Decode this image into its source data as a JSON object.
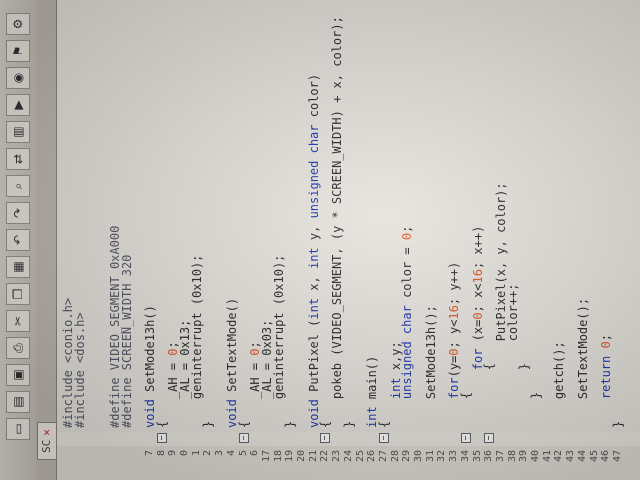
{
  "tab": {
    "label": "SC",
    "close": "✕"
  },
  "toolbar": {
    "icons": [
      "new-file-icon",
      "open-icon",
      "save-icon",
      "print-icon",
      "cut-icon",
      "copy-icon",
      "paste-icon",
      "undo-icon",
      "redo-icon",
      "find-icon",
      "replace-icon",
      "compile-icon",
      "run-icon",
      "debug-icon",
      "bookmark-icon",
      "settings-icon"
    ]
  },
  "code": {
    "lines": [
      {
        "n": "",
        "t": "#include <conio.h>"
      },
      {
        "n": "",
        "t": "#include <dos.h>"
      },
      {
        "n": "",
        "t": ""
      },
      {
        "n": "",
        "t": ""
      },
      {
        "n": "",
        "t": "#define VIDEO_SEGMENT 0xA000"
      },
      {
        "n": "",
        "t": "#define SCREEN_WIDTH 320"
      },
      {
        "n": "",
        "t": ""
      },
      {
        "n": "7",
        "t": "void SetMode13h()"
      },
      {
        "n": "8",
        "t": "{"
      },
      {
        "n": "9",
        "t": "    _AH = 0;"
      },
      {
        "n": "0",
        "t": "    _AL = 0x13;"
      },
      {
        "n": "1",
        "t": "    geninterrupt (0x10);"
      },
      {
        "n": "2",
        "t": "}"
      },
      {
        "n": "3",
        "t": ""
      },
      {
        "n": "4",
        "t": "void SetTextMode()"
      },
      {
        "n": "5",
        "t": "{"
      },
      {
        "n": "6",
        "t": "    _AH = 0;"
      },
      {
        "n": "17",
        "t": "    _AL = 0x03;"
      },
      {
        "n": "18",
        "t": "    geninterrupt (0x10);"
      },
      {
        "n": "19",
        "t": "}"
      },
      {
        "n": "20",
        "t": ""
      },
      {
        "n": "21",
        "t": "void PutPixel (int x, int y, unsigned char color)"
      },
      {
        "n": "22",
        "t": "{"
      },
      {
        "n": "23",
        "t": "    pokeb (VIDEO_SEGMENT, (y * SCREEN_WIDTH) + x, color);"
      },
      {
        "n": "24",
        "t": "}"
      },
      {
        "n": "25",
        "t": ""
      },
      {
        "n": "26",
        "t": "int main()"
      },
      {
        "n": "27",
        "t": "{"
      },
      {
        "n": "28",
        "t": "    int x,y;"
      },
      {
        "n": "29",
        "t": "    unsigned char color = 0;"
      },
      {
        "n": "30",
        "t": ""
      },
      {
        "n": "31",
        "t": "    SetMode13h();"
      },
      {
        "n": "32",
        "t": ""
      },
      {
        "n": "33",
        "t": "    for(y=0; y<16; y++)"
      },
      {
        "n": "34",
        "t": "    {"
      },
      {
        "n": "35",
        "t": "        for (x=0; x<16; x++)"
      },
      {
        "n": "36",
        "t": "        {"
      },
      {
        "n": "37",
        "t": "            PutPixel(x, y, color);"
      },
      {
        "n": "38",
        "t": "            color++;"
      },
      {
        "n": "39",
        "t": "        }"
      },
      {
        "n": "40",
        "t": "    }"
      },
      {
        "n": "41",
        "t": ""
      },
      {
        "n": "42",
        "t": "    getch();"
      },
      {
        "n": "43",
        "t": ""
      },
      {
        "n": "44",
        "t": "    SetTextMode();"
      },
      {
        "n": "45",
        "t": ""
      },
      {
        "n": "46",
        "t": "    return 0;"
      },
      {
        "n": "47",
        "t": "}"
      }
    ]
  },
  "colors": {
    "keyword": "#1d39b5",
    "number": "#e05a2a",
    "text": "#2b2b2b",
    "background": "#e7e4de"
  }
}
